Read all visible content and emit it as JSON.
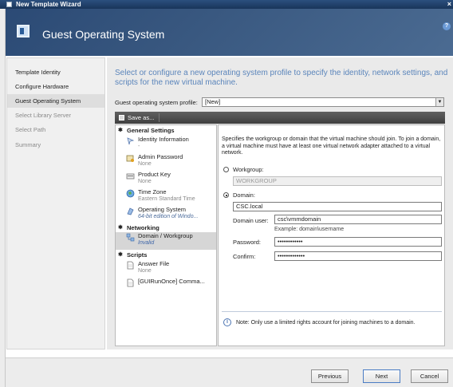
{
  "window": {
    "title": "New Template Wizard",
    "close": "×"
  },
  "header": {
    "page_title": "Guest Operating System",
    "help": "?"
  },
  "nav": {
    "items": [
      {
        "label": "Template Identity"
      },
      {
        "label": "Configure Hardware"
      },
      {
        "label": "Guest Operating System"
      },
      {
        "label": "Select Library Server"
      },
      {
        "label": "Select Path"
      },
      {
        "label": "Summary"
      }
    ]
  },
  "main": {
    "intro": "Select or configure a new operating system profile to specify the identity, network settings, and scripts for the new virtual machine.",
    "profile_label": "Guest operating system profile:",
    "profile_value": "[New]",
    "save_as": "Save as...",
    "tree": {
      "general_settings": "General Settings",
      "identity_information": "Identity Information",
      "identity_information_sub": "-",
      "admin_password": "Admin Password",
      "admin_password_sub": "None",
      "product_key": "Product Key",
      "product_key_sub": "None",
      "time_zone": "Time Zone",
      "time_zone_sub": "Eastern Standard Time",
      "operating_system": "Operating System",
      "operating_system_sub": "64-bit edition of Windo...",
      "networking": "Networking",
      "domain_workgroup": "Domain / Workgroup",
      "domain_workgroup_sub": "Invalid",
      "scripts": "Scripts",
      "answer_file": "Answer File",
      "answer_file_sub": "None",
      "gui_run_once": "[GUIRunOnce] Comma..."
    },
    "detail": {
      "description": "Specifies the workgroup or domain that the virtual machine should join.  To join a domain, a virtual machine must have at least one virtual network adapter attached to a virtual network.",
      "workgroup_label": "Workgroup:",
      "workgroup_value": "WORKGROUP",
      "domain_label": "Domain:",
      "domain_value": "CSC.local",
      "domain_user_label": "Domain user:",
      "domain_user_value": "csc\\vmmdomain",
      "domain_user_example": "Example: domain\\username",
      "password_label": "Password:",
      "password_value": "••••••••••••",
      "confirm_label": "Confirm:",
      "confirm_value": "•••••••••••••",
      "note": "Note: Only use a limited rights account for joining machines to a domain.",
      "note_icon": "i"
    }
  },
  "footer": {
    "previous": "Previous",
    "next": "Next",
    "cancel": "Cancel"
  }
}
